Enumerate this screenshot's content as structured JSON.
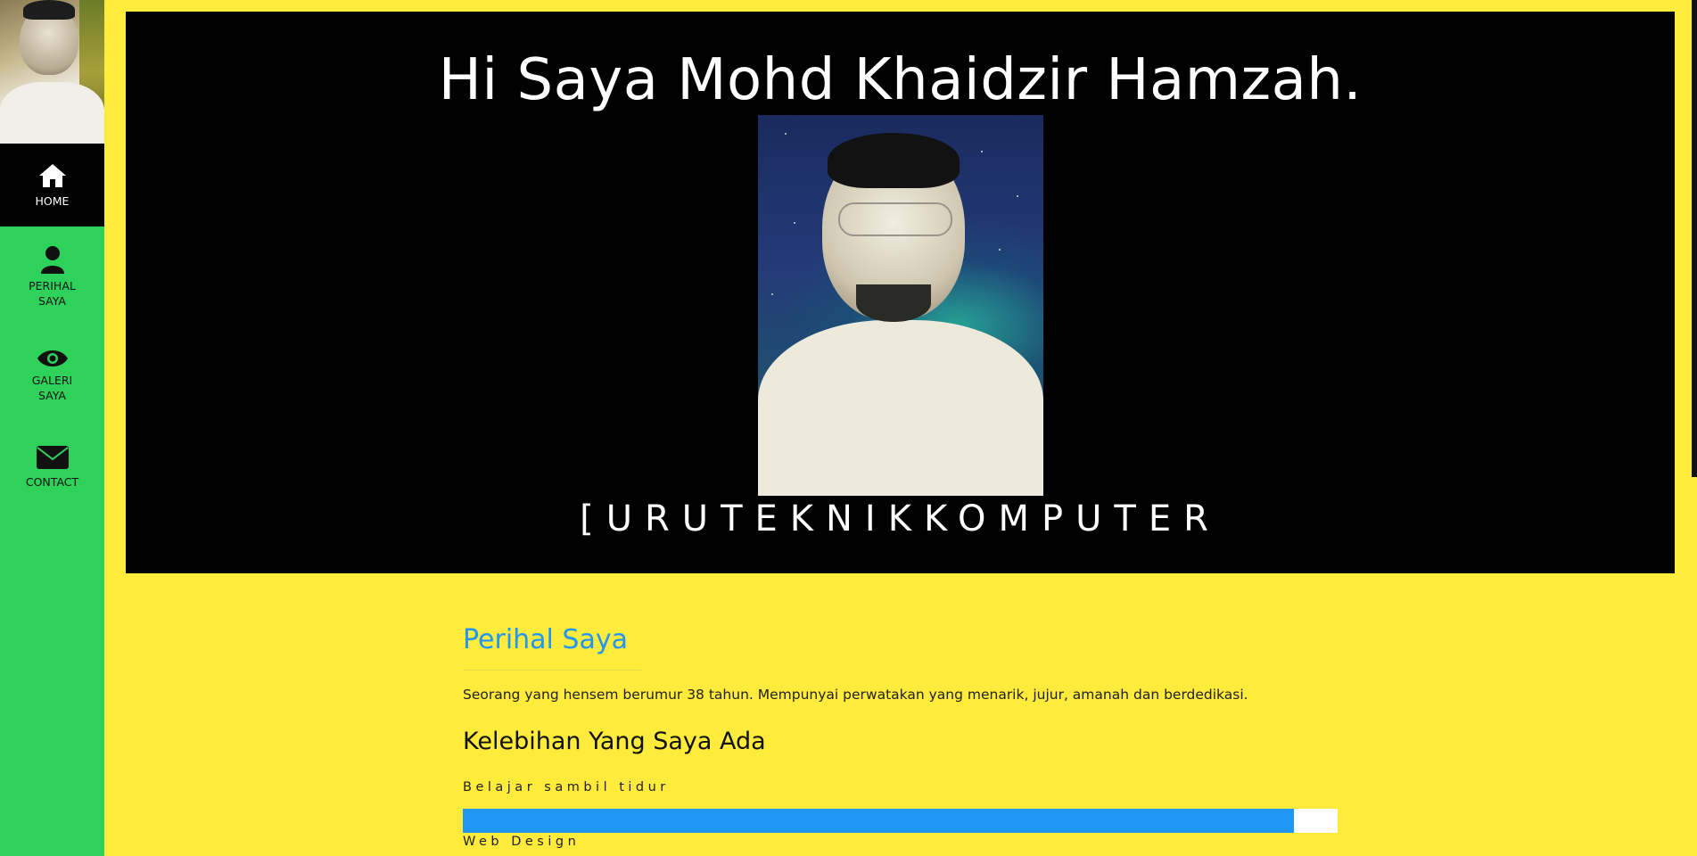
{
  "sidebar": {
    "items": [
      {
        "label": "HOME",
        "icon": "home-icon"
      },
      {
        "label": "PERIHAL\nSAYA",
        "icon": "user-icon"
      },
      {
        "label": "GALERI\nSAYA",
        "icon": "eye-icon"
      },
      {
        "label": "CONTACT",
        "icon": "envelope-icon"
      }
    ],
    "colors": {
      "background": "#2ed15a",
      "active": "#000000"
    }
  },
  "hero": {
    "title": "Hi Saya Mohd Khaidzir Hamzah.",
    "subtitle": "[URUTEKNIKKOMPUTER"
  },
  "about": {
    "title": "Perihal Saya",
    "description": "Seorang yang hensem berumur 38 tahun. Mempunyai perwatakan yang menarik, jujur, amanah dan berdedikasi.",
    "skills_title": "Kelebihan Yang Saya Ada",
    "skills": [
      {
        "label": "Belajar sambil tidur",
        "percent": 95
      },
      {
        "label": "Web Design"
      }
    ]
  },
  "colors": {
    "page_background": "#ffeb3b",
    "accent": "#2196f3"
  }
}
